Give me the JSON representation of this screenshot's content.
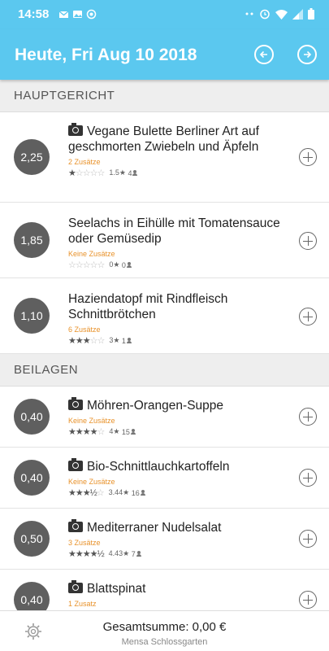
{
  "statusbar": {
    "time": "14:58"
  },
  "header": {
    "title": "Heute, Fri Aug 10 2018"
  },
  "sections": [
    {
      "title": "HAUPTGERICHT",
      "meals": [
        {
          "price": "2,25",
          "camera": true,
          "name": "Vegane Bulette Berliner Art auf geschmorten Zwiebeln und Äpfeln",
          "extras": "2 Zusätze",
          "rating": 1.5,
          "rating_text": "1.5★",
          "votes": "4"
        },
        {
          "price": "1,85",
          "camera": false,
          "name": "Seelachs in Eihülle mit Tomatensauce oder Gemüsedip",
          "extras": "Keine Zusätze",
          "rating": 0,
          "rating_text": "0★",
          "votes": "0"
        },
        {
          "price": "1,10",
          "camera": false,
          "name": "Haziendatopf mit Rindfleisch Schnittbrötchen",
          "extras": "6 Zusätze",
          "rating": 3,
          "rating_text": "3★",
          "votes": "1"
        }
      ]
    },
    {
      "title": "BEILAGEN",
      "meals": [
        {
          "price": "0,40",
          "camera": true,
          "name": "Möhren-Orangen-Suppe",
          "extras": "Keine Zusätze",
          "rating": 4,
          "rating_text": "4★",
          "votes": "15"
        },
        {
          "price": "0,40",
          "camera": true,
          "name": "Bio-Schnittlauchkartoffeln",
          "extras": "Keine Zusätze",
          "rating": 3.44,
          "rating_text": "3.44★",
          "votes": "16"
        },
        {
          "price": "0,50",
          "camera": true,
          "name": "Mediterraner Nudelsalat",
          "extras": "3 Zusätze",
          "rating": 4.43,
          "rating_text": "4.43★",
          "votes": "7"
        },
        {
          "price": "0,40",
          "camera": true,
          "name": "Blattspinat",
          "extras": "1 Zusatz",
          "rating": 0,
          "rating_text": "",
          "votes": ""
        }
      ]
    }
  ],
  "footer": {
    "total": "Gesamtsumme: 0,00 €",
    "location": "Mensa Schlossgarten"
  },
  "colors": {
    "primary": "#5bc8ef",
    "price_badge": "#5f5f5f",
    "extras": "#e8922b"
  }
}
